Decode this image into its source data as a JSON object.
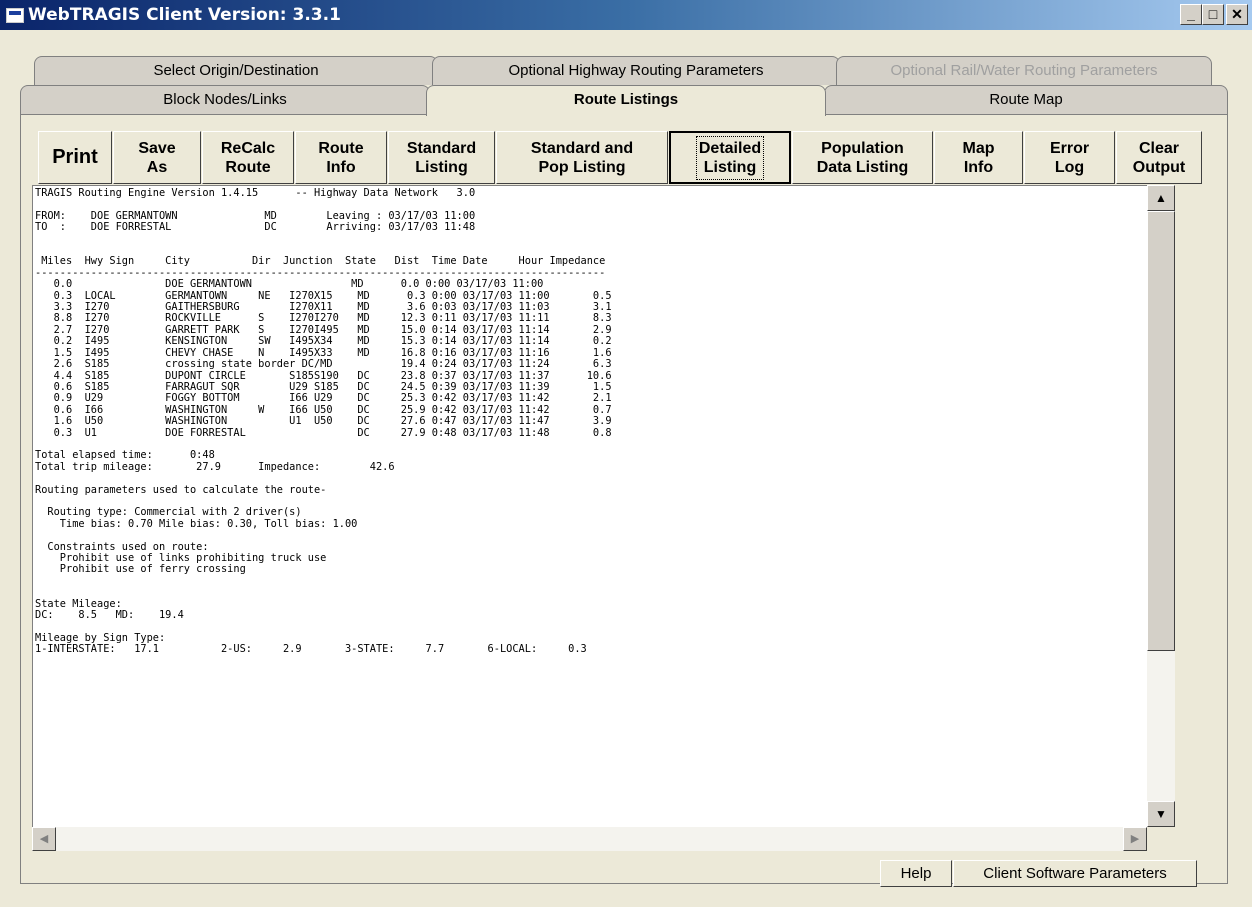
{
  "window": {
    "title": "WebTRAGIS Client Version: 3.3.1",
    "minimize": "_",
    "maximize": "□",
    "close": "✕"
  },
  "tabs_row1": [
    "Select Origin/Destination",
    "Optional Highway Routing Parameters",
    "Optional Rail/Water Routing Parameters"
  ],
  "tabs_row2": [
    "Block Nodes/Links",
    "Route Listings",
    "Route Map"
  ],
  "active_tab": "Route Listings",
  "toolbar": {
    "print": "Print",
    "save_as": "Save\nAs",
    "recalc_route": "ReCalc\nRoute",
    "route_info": "Route\nInfo",
    "standard_listing": "Standard\nListing",
    "standard_pop_listing": "Standard and\nPop Listing",
    "detailed_listing": "Detailed\nListing",
    "population_data_listing": "Population\nData Listing",
    "map_info": "Map\nInfo",
    "error_log": "Error\nLog",
    "clear_output": "Clear\nOutput"
  },
  "output_text": "TRAGIS Routing Engine Version 1.4.15      -- Highway Data Network   3.0\n\nFROM:    DOE GERMANTOWN              MD        Leaving : 03/17/03 11:00\nTO  :    DOE FORRESTAL               DC        Arriving: 03/17/03 11:48\n\n\n Miles  Hwy Sign     City          Dir  Junction  State   Dist  Time Date     Hour Impedance\n--------------------------------------------------------------------------------------------\n   0.0               DOE GERMANTOWN                MD      0.0 0:00 03/17/03 11:00\n   0.3  LOCAL        GERMANTOWN     NE   I270X15    MD      0.3 0:00 03/17/03 11:00       0.5\n   3.3  I270         GAITHERSBURG        I270X11    MD      3.6 0:03 03/17/03 11:03       3.1\n   8.8  I270         ROCKVILLE      S    I270I270   MD     12.3 0:11 03/17/03 11:11       8.3\n   2.7  I270         GARRETT PARK   S    I270I495   MD     15.0 0:14 03/17/03 11:14       2.9\n   0.2  I495         KENSINGTON     SW   I495X34    MD     15.3 0:14 03/17/03 11:14       0.2\n   1.5  I495         CHEVY CHASE    N    I495X33    MD     16.8 0:16 03/17/03 11:16       1.6\n   2.6  S185         crossing state border DC/MD           19.4 0:24 03/17/03 11:24       6.3\n   4.4  S185         DUPONT CIRCLE       S185S190   DC     23.8 0:37 03/17/03 11:37      10.6\n   0.6  S185         FARRAGUT SQR        U29 S185   DC     24.5 0:39 03/17/03 11:39       1.5\n   0.9  U29          FOGGY BOTTOM        I66 U29    DC     25.3 0:42 03/17/03 11:42       2.1\n   0.6  I66          WASHINGTON     W    I66 U50    DC     25.9 0:42 03/17/03 11:42       0.7\n   1.6  U50          WASHINGTON          U1  U50    DC     27.6 0:47 03/17/03 11:47       3.9\n   0.3  U1           DOE FORRESTAL                  DC     27.9 0:48 03/17/03 11:48       0.8\n\nTotal elapsed time:      0:48\nTotal trip mileage:       27.9      Impedance:        42.6\n\nRouting parameters used to calculate the route-\n\n  Routing type: Commercial with 2 driver(s)\n    Time bias: 0.70 Mile bias: 0.30, Toll bias: 1.00\n\n  Constraints used on route:\n    Prohibit use of links prohibiting truck use\n    Prohibit use of ferry crossing\n\n\nState Mileage:\nDC:    8.5   MD:    19.4\n\nMileage by Sign Type:\n1-INTERSTATE:   17.1          2-US:     2.9       3-STATE:     7.7       6-LOCAL:     0.3",
  "footer": {
    "help": "Help",
    "client_params": "Client Software Parameters"
  }
}
